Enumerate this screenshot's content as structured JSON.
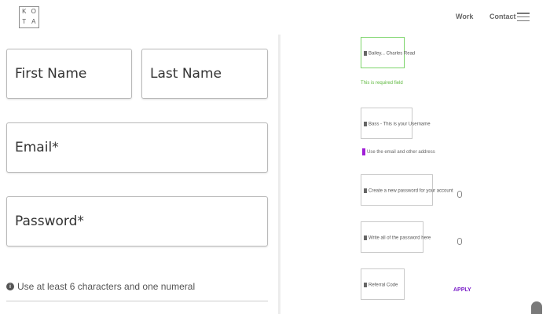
{
  "header": {
    "logo_letters": [
      "K",
      "O",
      "T",
      "A"
    ],
    "nav": {
      "work_label": "Work",
      "contact_label": "Contact"
    }
  },
  "form": {
    "first_name_placeholder": "First Name",
    "last_name_placeholder": "Last Name",
    "email_placeholder": "Email*",
    "password_placeholder": "Password*",
    "password_hint": "Use at least 6 characters and one numeral"
  },
  "preview": {
    "field1": "Bailey... Charles Read",
    "green_note": "This is required field",
    "field2": "Bass - This is your Username",
    "purple_note": "Use the email and other address",
    "field3": "Create a new password for your account",
    "field4": "Write all of the password here",
    "field5": "Referral Code",
    "purple_tag": "APPLY"
  },
  "colors": {
    "accent_green": "#7cd46a",
    "accent_purple": "#a01fd6",
    "border": "#b9b9b9"
  }
}
